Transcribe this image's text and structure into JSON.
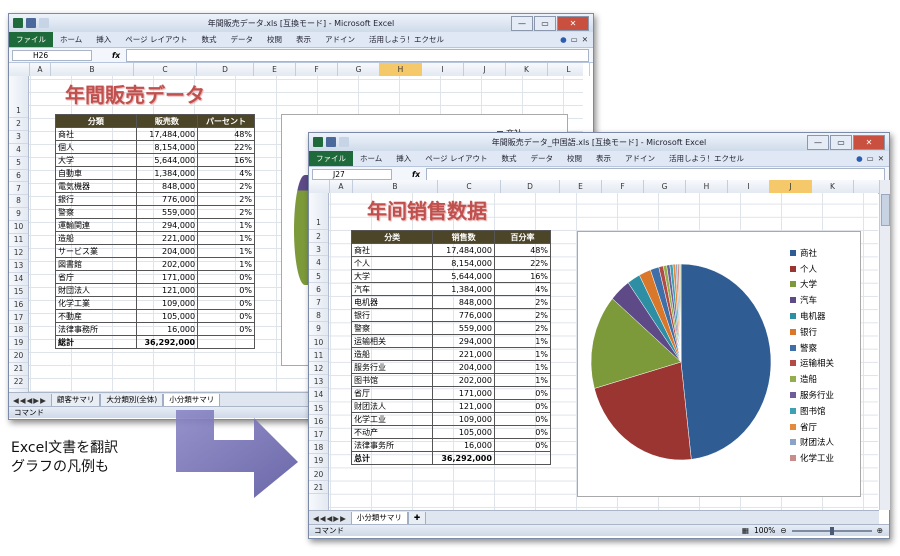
{
  "back": {
    "title": "年間販売データ.xls [互換モード] - Microsoft Excel",
    "ribbon": {
      "file": "ファイル",
      "tabs": [
        "ホーム",
        "挿入",
        "ページ レイアウト",
        "数式",
        "データ",
        "校閲",
        "表示",
        "アドイン",
        "活用しよう！エクセル"
      ]
    },
    "namebox": "H26",
    "fx": "fx",
    "columns": [
      "A",
      "B",
      "C",
      "D",
      "E",
      "F",
      "G",
      "H",
      "I",
      "J",
      "K",
      "L"
    ],
    "selected_column": "H",
    "sheet_title": "年間販売データ",
    "headers": [
      "分類",
      "販売数",
      "パーセント"
    ],
    "rows": [
      [
        "商社",
        "17,484,000",
        "48%"
      ],
      [
        "個人",
        "8,154,000",
        "22%"
      ],
      [
        "大学",
        "5,644,000",
        "16%"
      ],
      [
        "自動車",
        "1,384,000",
        "4%"
      ],
      [
        "電気機器",
        "848,000",
        "2%"
      ],
      [
        "銀行",
        "776,000",
        "2%"
      ],
      [
        "警察",
        "559,000",
        "2%"
      ],
      [
        "運輸関連",
        "294,000",
        "1%"
      ],
      [
        "造船",
        "221,000",
        "1%"
      ],
      [
        "サービス業",
        "204,000",
        "1%"
      ],
      [
        "図書館",
        "202,000",
        "1%"
      ],
      [
        "省庁",
        "171,000",
        "0%"
      ],
      [
        "財団法人",
        "121,000",
        "0%"
      ],
      [
        "化学工業",
        "109,000",
        "0%"
      ],
      [
        "不動産",
        "105,000",
        "0%"
      ],
      [
        "法律事務所",
        "16,000",
        "0%"
      ]
    ],
    "total": [
      "総計",
      "36,292,000"
    ],
    "legend_peek": "商社",
    "sheet_tabs": [
      "顧客サマリ",
      "大分類別(全体)",
      "小分類サマリ"
    ],
    "status": "コマンド"
  },
  "front": {
    "title": "年間販売データ_中国語.xls [互換モード] - Microsoft Excel",
    "ribbon": {
      "file": "ファイル",
      "tabs": [
        "ホーム",
        "挿入",
        "ページ レイアウト",
        "数式",
        "データ",
        "校閲",
        "表示",
        "アドイン",
        "活用しよう！エクセル"
      ]
    },
    "namebox": "J27",
    "fx": "fx",
    "columns": [
      "A",
      "B",
      "C",
      "D",
      "E",
      "F",
      "G",
      "H",
      "I",
      "J",
      "K"
    ],
    "selected_column": "J",
    "sheet_title": "年间销售数据",
    "headers": [
      "分类",
      "销售数",
      "百分率"
    ],
    "rows": [
      [
        "商社",
        "17,484,000",
        "48%"
      ],
      [
        "个人",
        "8,154,000",
        "22%"
      ],
      [
        "大学",
        "5,644,000",
        "16%"
      ],
      [
        "汽车",
        "1,384,000",
        "4%"
      ],
      [
        "电机器",
        "848,000",
        "2%"
      ],
      [
        "银行",
        "776,000",
        "2%"
      ],
      [
        "警察",
        "559,000",
        "2%"
      ],
      [
        "运输相关",
        "294,000",
        "1%"
      ],
      [
        "造船",
        "221,000",
        "1%"
      ],
      [
        "服务行业",
        "204,000",
        "1%"
      ],
      [
        "图书馆",
        "202,000",
        "1%"
      ],
      [
        "省厅",
        "171,000",
        "0%"
      ],
      [
        "财团法人",
        "121,000",
        "0%"
      ],
      [
        "化学工业",
        "109,000",
        "0%"
      ],
      [
        "不动产",
        "105,000",
        "0%"
      ],
      [
        "法律事务所",
        "16,000",
        "0%"
      ]
    ],
    "total": [
      "总计",
      "36,292,000"
    ],
    "sheet_tabs": [
      "小分類サマリ"
    ],
    "status": "コマンド",
    "zoom": "100%"
  },
  "caption": {
    "line1": "Excel文書を翻訳",
    "line2": "グラフの凡例も"
  },
  "chart_data": {
    "type": "pie",
    "categories": [
      "商社",
      "个人",
      "大学",
      "汽车",
      "电机器",
      "银行",
      "警察",
      "运输相关",
      "造船",
      "服务行业",
      "图书馆",
      "省厅",
      "财团法人",
      "化学工业",
      "不动产",
      "法律事务所"
    ],
    "values": [
      17484000,
      8154000,
      5644000,
      1384000,
      848000,
      776000,
      559000,
      294000,
      221000,
      204000,
      202000,
      171000,
      121000,
      109000,
      105000,
      16000
    ],
    "legend_visible": [
      "商社",
      "个人",
      "大学",
      "汽车",
      "电机器",
      "银行",
      "警察",
      "运输相关",
      "造船",
      "服务行业",
      "图书馆",
      "省厅",
      "财团法人",
      "化学工业"
    ],
    "colors": [
      "#2e5c93",
      "#9a3532",
      "#7d9a3a",
      "#5d4a86",
      "#2e8ea3",
      "#d9772b",
      "#3f6fa8",
      "#b24a45",
      "#92ae4d",
      "#6f5c9a",
      "#3fa0b3",
      "#e48a3c",
      "#8aa4c8",
      "#c98c8a",
      "#b3c98e",
      "#a596be"
    ],
    "legend_position": "right"
  }
}
